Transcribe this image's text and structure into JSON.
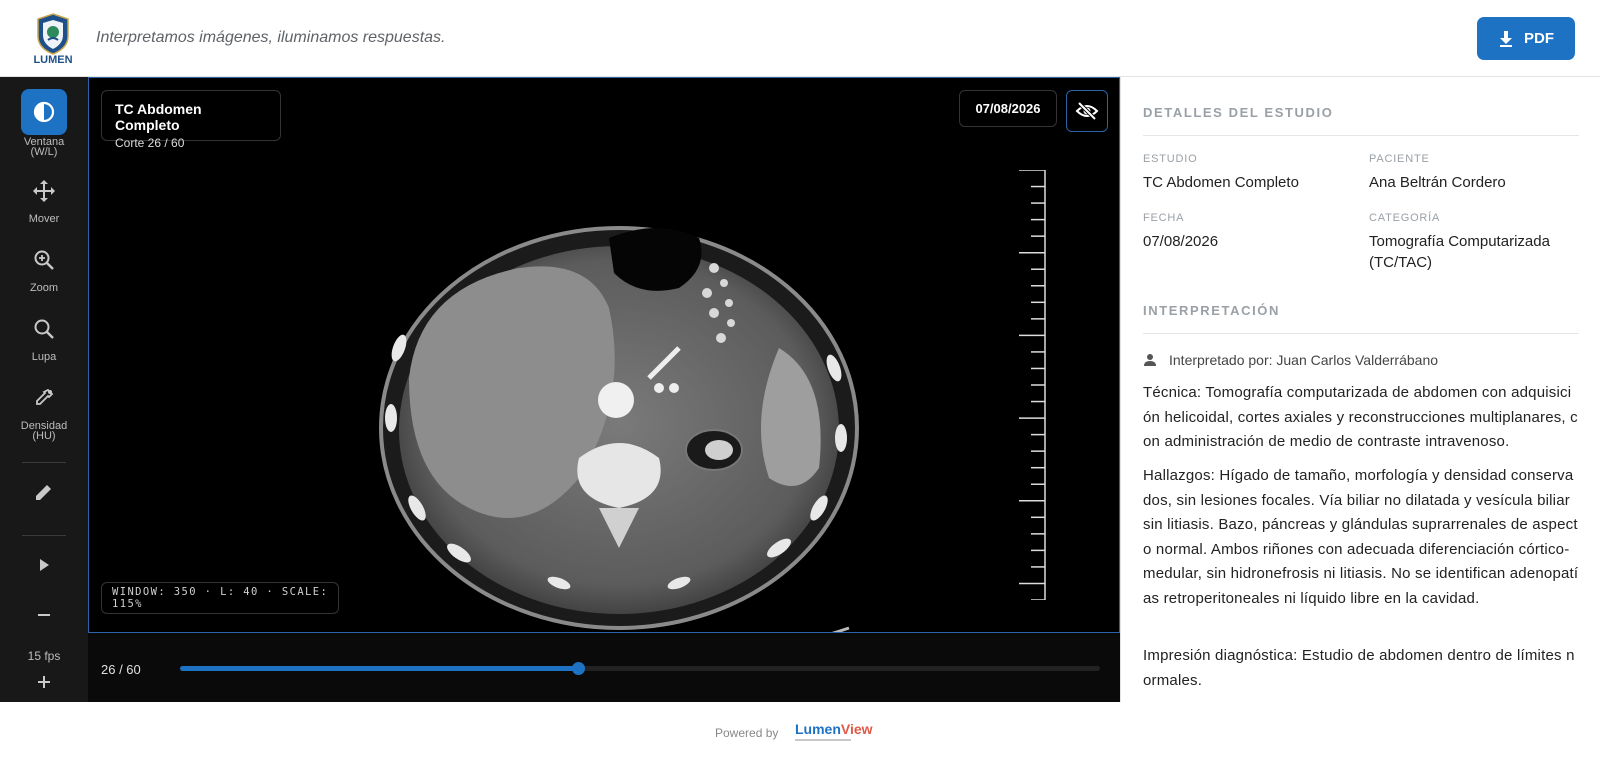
{
  "header": {
    "logo_text": "LUMEN",
    "tagline": "Interpretamos imágenes, iluminamos respuestas.",
    "pdf_label": "PDF"
  },
  "toolbar": {
    "tools": [
      {
        "label": "Ventana\n(W/L)",
        "icon": "contrast-icon",
        "active": true
      },
      {
        "label": "Mover",
        "icon": "move-icon"
      },
      {
        "label": "Zoom",
        "icon": "zoom-in-icon"
      },
      {
        "label": "Lupa",
        "icon": "magnifier-icon"
      },
      {
        "label": "Densidad\n(HU)",
        "icon": "eyedropper-icon"
      }
    ],
    "annotate_icon": "pencil-icon",
    "play_icon": "play-icon",
    "fps_label": "15 fps"
  },
  "viewer": {
    "study_title": "TC Abdomen Completo",
    "slice_label": "Corte 26 / 60",
    "date": "07/08/2026",
    "overlay_toggle_icon": "eye-off-icon",
    "window_info": "WINDOW: 350 · L: 40 · SCALE: 115%",
    "slice_counter": "26 / 60",
    "slice_current": 26,
    "slice_total": 60
  },
  "details": {
    "section_title": "DETALLES DEL ESTUDIO",
    "study_label": "ESTUDIO",
    "study_value": "TC Abdomen Completo",
    "patient_label": "PACIENTE",
    "patient_value": "Ana Beltrán Cordero",
    "date_label": "FECHA",
    "date_value": "07/08/2026",
    "category_label": "CATEGORÍA",
    "category_value": "Tomografía Computarizada (TC/TAC)"
  },
  "interpretation": {
    "section_title": "INTERPRETACIÓN",
    "by": "Interpretado por: Juan Carlos Valderrábano",
    "p1": "Técnica: Tomografía computarizada de abdomen con adquisición helicoidal, cortes axiales y reconstrucciones multiplanares, con administración de medio de contraste intravenoso.",
    "p2": "Hallazgos: Hígado de tamaño, morfología y densidad conservados, sin lesiones focales. Vía biliar no dilatada y vesícula biliar sin litiasis. Bazo, páncreas y glándulas suprarrenales de aspecto normal. Ambos riñones con adecuada diferenciación córtico-medular, sin hidronefrosis ni litiasis. No se identifican adenopatías retroperitoneales ni líquido libre en la cavidad.",
    "p3": "Impresión diagnóstica: Estudio de abdomen dentro de límites normales."
  },
  "footer": {
    "powered_by": "Powered by",
    "brand_a": "Lumen",
    "brand_b": "View"
  }
}
